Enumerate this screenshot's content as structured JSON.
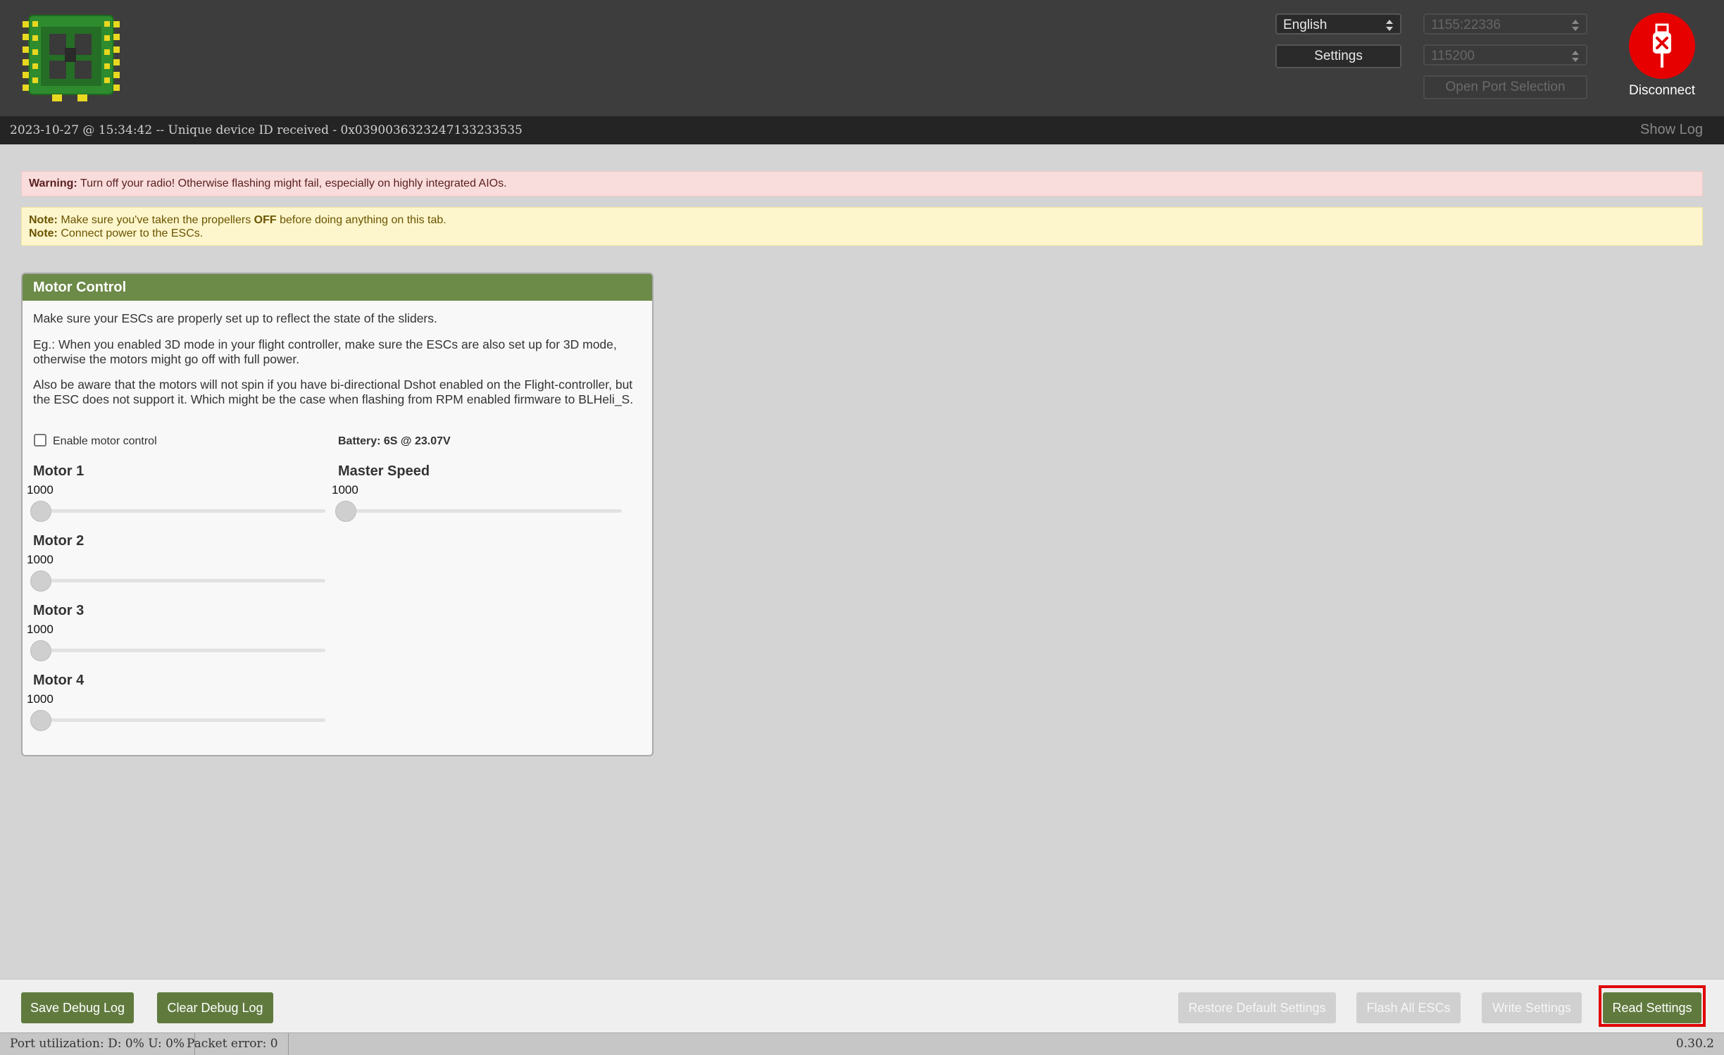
{
  "header": {
    "language_select": "English",
    "settings_label": "Settings",
    "port_select": "1155:22336",
    "baud_select": "115200",
    "open_port_label": "Open Port Selection",
    "disconnect_label": "Disconnect",
    "accent_color": "#e60000"
  },
  "log": {
    "message": "2023-10-27 @ 15:34:42 -- Unique device ID received - 0x0390036323247133233535",
    "show_log_label": "Show Log"
  },
  "notes": {
    "warning_label": "Warning:",
    "warning_text": "Turn off your radio! Otherwise flashing might fail, especially on highly integrated AIOs.",
    "note1_label": "Note:",
    "note1_pre": "Make sure you've taken the propellers",
    "note1_bold": "OFF",
    "note1_post": "before doing anything on this tab.",
    "note2_label": "Note:",
    "note2_text": "Connect power to the ESCs."
  },
  "motor_control": {
    "title": "Motor Control",
    "para1": "Make sure your ESCs are properly set up to reflect the state of the sliders.",
    "para2": "Eg.: When you enabled 3D mode in your flight controller, make sure the ESCs are also set up for 3D mode, otherwise the motors might go off with full power.",
    "para3": "Also be aware that the motors will not spin if you have bi-directional Dshot enabled on the Flight-controller, but the ESC does not support it. Which might be the case when flashing from RPM enabled firmware to BLHeli_S.",
    "enable_label": "Enable motor control",
    "enable_checked": false,
    "battery": "Battery: 6S @ 23.07V",
    "motors": [
      {
        "name": "Motor 1",
        "value": "1000"
      },
      {
        "name": "Motor 2",
        "value": "1000"
      },
      {
        "name": "Motor 3",
        "value": "1000"
      },
      {
        "name": "Motor 4",
        "value": "1000"
      }
    ],
    "master": {
      "name": "Master Speed",
      "value": "1000"
    }
  },
  "buttons": {
    "save_debug_log": "Save Debug Log",
    "clear_debug_log": "Clear Debug Log",
    "restore_defaults": "Restore Default Settings",
    "flash_all": "Flash All ESCs",
    "write_settings": "Write Settings",
    "read_settings": "Read Settings",
    "button_color": "#607a3e"
  },
  "status": {
    "port_utilization": "Port utilization: D: 0% U: 0%",
    "packet_error": "Packet error: 0",
    "version": "0.30.2"
  }
}
